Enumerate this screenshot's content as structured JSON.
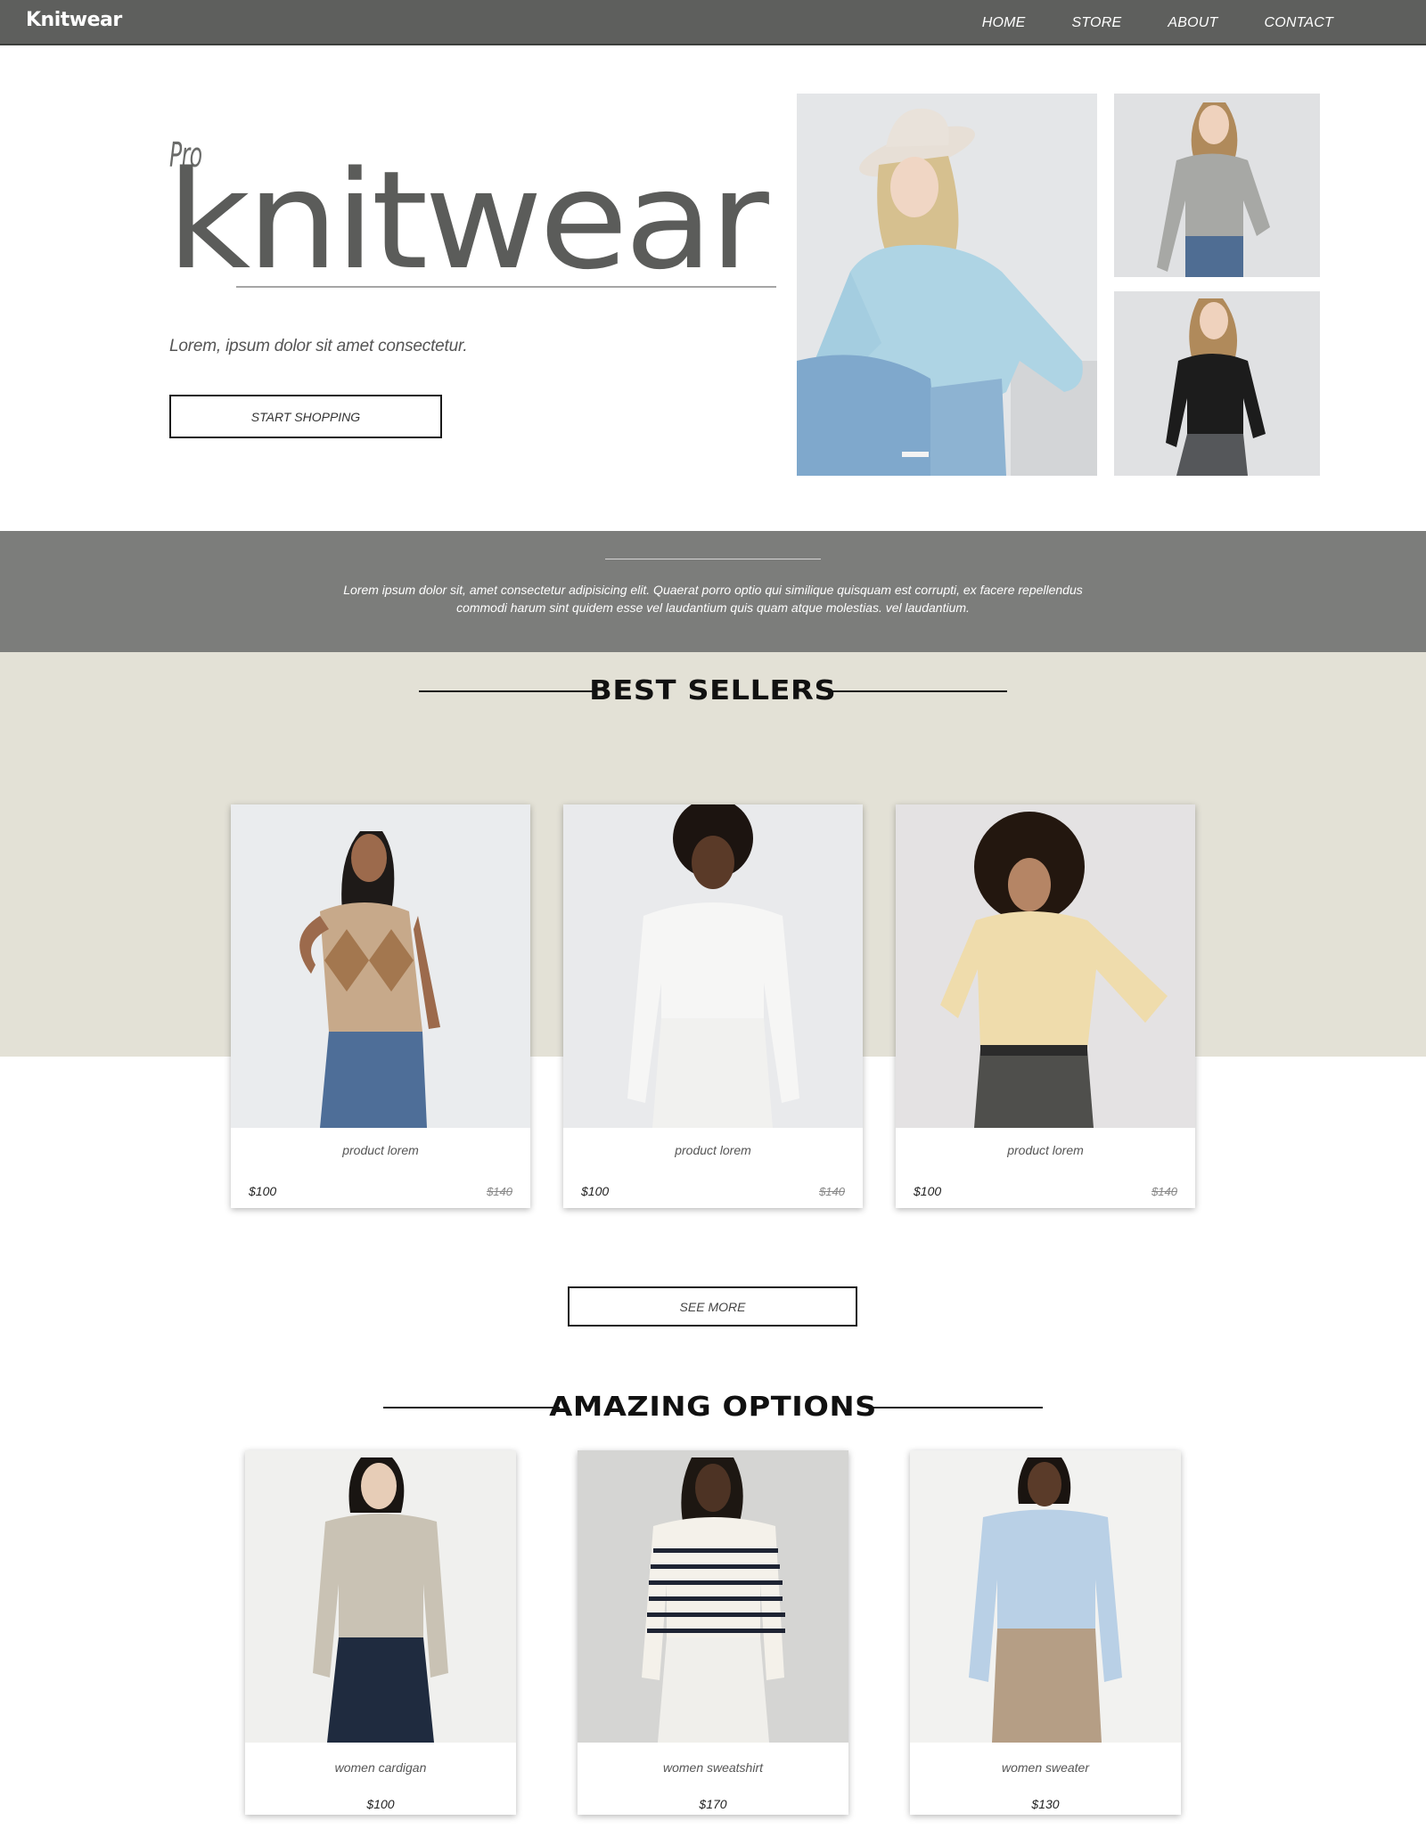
{
  "nav": {
    "logo": "Knitwear",
    "links": [
      "HOME",
      "STORE",
      "ABOUT",
      "CONTACT"
    ]
  },
  "hero": {
    "pre_title": "Pro",
    "title": "knitwear",
    "subtitle": "Lorem, ipsum dolor sit amet consectetur.",
    "button": "START SHOPPING"
  },
  "band": {
    "text": "Lorem ipsum dolor sit, amet consectetur adipisicing elit. Quaerat porro optio qui similique quisquam est corrupti, ex facere repellendus commodi harum sint quidem esse vel laudantium quis quam atque molestias. vel laudantium."
  },
  "best_sellers": {
    "title": "BEST SELLERS",
    "products": [
      {
        "name": "product lorem",
        "price": "$100",
        "old_price": "$140"
      },
      {
        "name": "product lorem",
        "price": "$100",
        "old_price": "$140"
      },
      {
        "name": "product lorem",
        "price": "$100",
        "old_price": "$140"
      }
    ],
    "see_more": "SEE MORE"
  },
  "amazing_options": {
    "title": "AMAZING OPTIONS",
    "products": [
      {
        "name": "women cardigan",
        "price": "$100"
      },
      {
        "name": "women sweatshirt",
        "price": "$170"
      },
      {
        "name": "women sweater",
        "price": "$130"
      }
    ]
  },
  "colors": {
    "nav_bg": "#5e5f5d",
    "band_bg": "#7c7d7b",
    "beige_bg": "#e3e1d6",
    "title_gray": "#5b5c5a"
  }
}
